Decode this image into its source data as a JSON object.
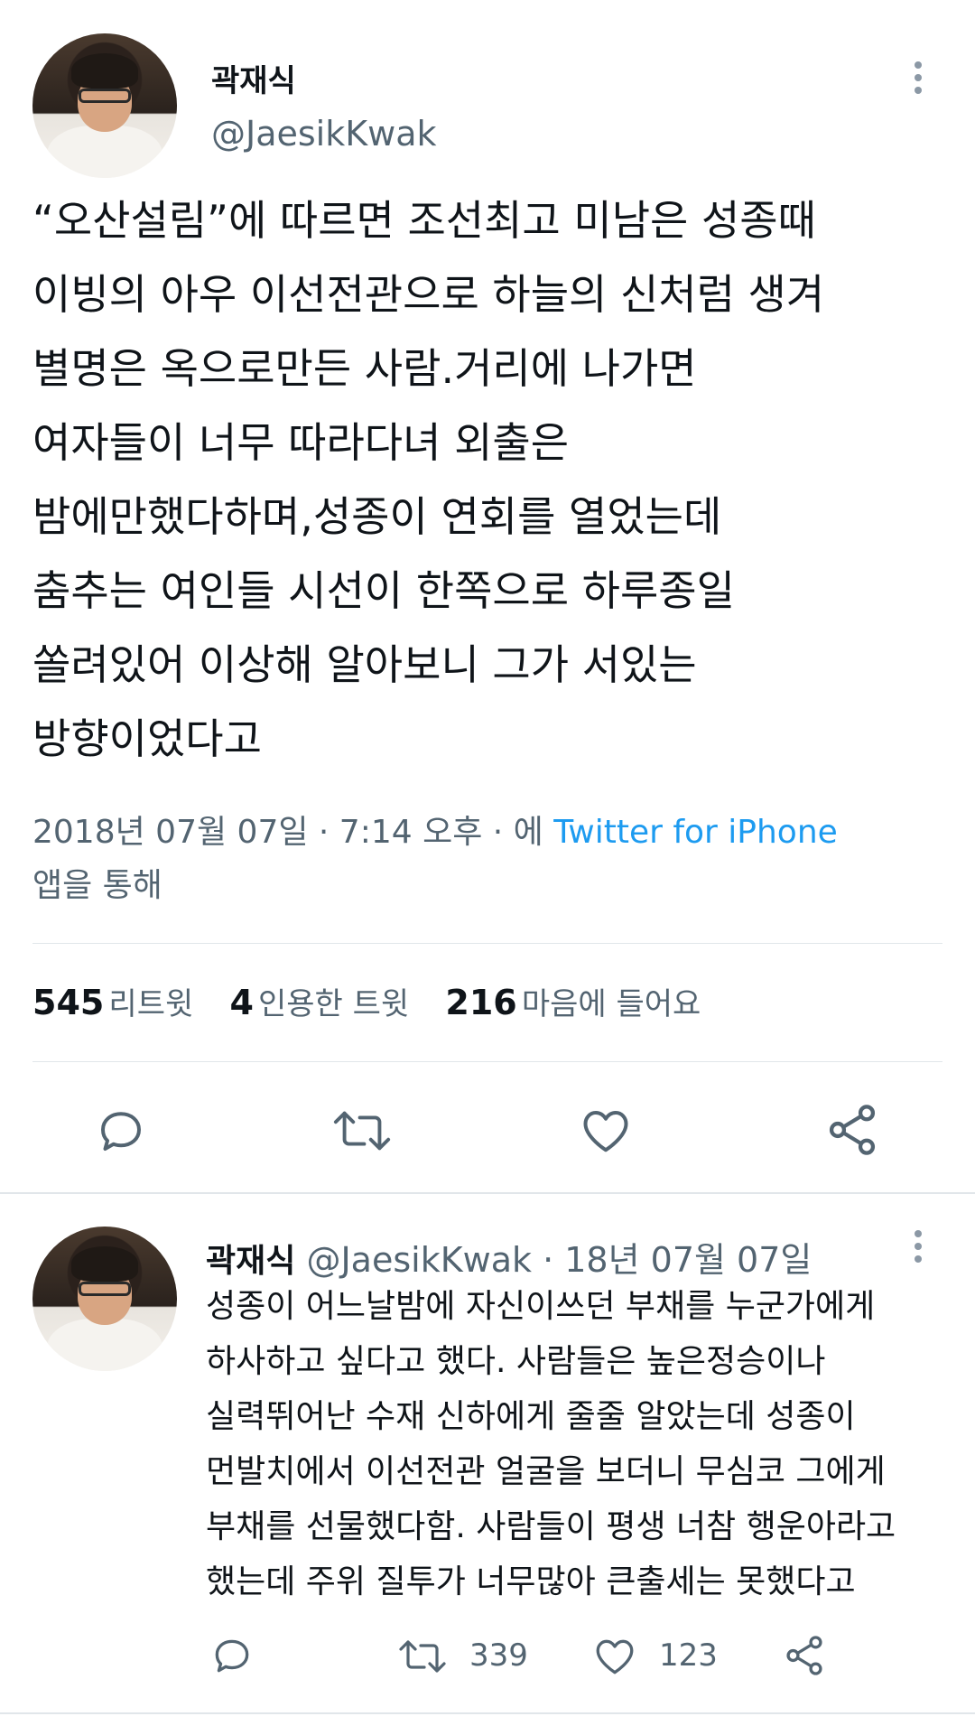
{
  "main_tweet": {
    "author_name": "곽재식",
    "author_handle": "@JaesikKwak",
    "text_lines": [
      "“오산설림”에 따르면 조선최고 미남은 성종때",
      "이빙의 아우 이선전관으로 하늘의 신처럼 생겨",
      "별명은 옥으로만든 사람.거리에 나가면",
      "여자들이 너무 따라다녀 외출은",
      "밤에만했다하며,성종이 연회를 열었는데",
      "춤추는 여인들 시선이 한쪽으로 하루종일",
      "쏠려있어 이상해 알아보니 그가 서있는",
      "방향이었다고"
    ],
    "timestamp": "2018년 07월 07일 · 7:14 오후 · 에 ",
    "source_app": "Twitter for iPhone",
    "source_suffix": "앱을 통해",
    "stats": {
      "retweets_count": "545",
      "retweets_label": "리트윗",
      "quotes_count": "4",
      "quotes_label": "인용한 트윗",
      "likes_count": "216",
      "likes_label": "마음에 들어요"
    },
    "actions": [
      "reply-icon",
      "retweet-icon",
      "heart-icon",
      "share-icon"
    ]
  },
  "reply_tweet": {
    "author_name": "곽재식",
    "author_handle": "@JaesikKwak",
    "date": "· 18년 07월 07일",
    "text_lines": [
      "성종이 어느날밤에 자신이쓰던 부채를 누군가에게",
      "하사하고 싶다고 했다. 사람들은 높은정승이나",
      "실력뛰어난 수재 신하에게 줄줄 알았는데 성종이",
      "먼발치에서 이선전관 얼굴을 보더니 무심코 그에게",
      "부채를 선물했다함. 사람들이 평생 너참 행운아라고",
      "했는데 주위 질투가 너무많아 큰출세는 못했다고"
    ],
    "retweet_count": "339",
    "like_count": "123"
  },
  "colors": {
    "text": "#0f1419",
    "secondary": "#536471",
    "link": "#1d9bf0",
    "divider": "#e1e6ea"
  }
}
